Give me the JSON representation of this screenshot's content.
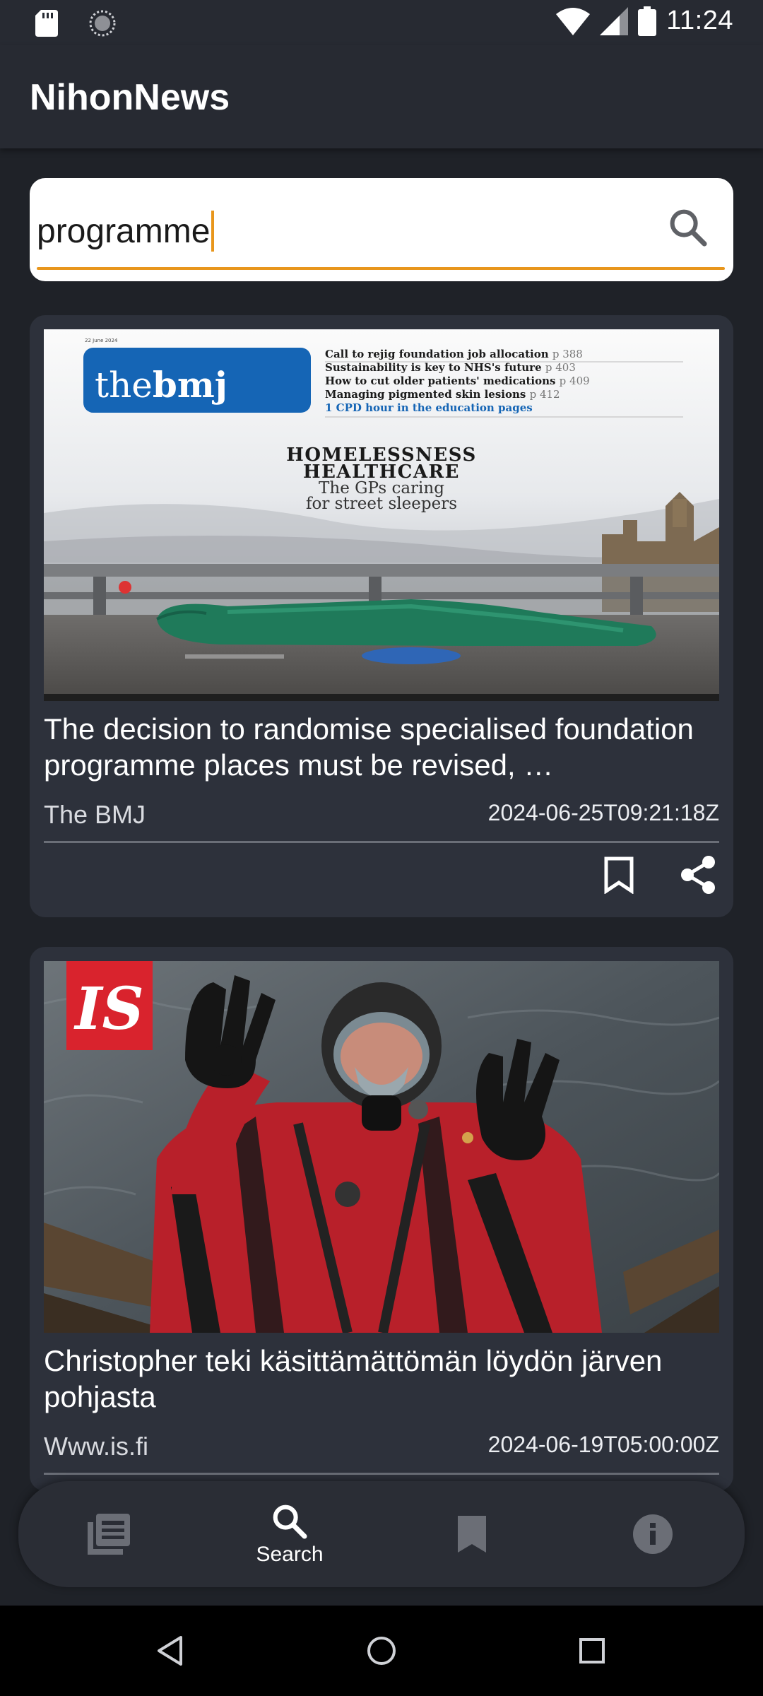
{
  "status_bar": {
    "time": "11:24",
    "icons": [
      "sd-card-icon",
      "sync-icon",
      "wifi-icon",
      "signal-icon",
      "battery-icon"
    ]
  },
  "app_bar": {
    "title": "NihonNews"
  },
  "search": {
    "value": "programme",
    "placeholder": "",
    "accent_color": "#e8961c"
  },
  "articles": [
    {
      "title": "The decision to randomise specialised foundation programme places must be revised, …",
      "source": "The BMJ",
      "date": "2024-06-25T09:21:18Z",
      "image": {
        "masthead": "the",
        "masthead_bold": "bmj",
        "issue_line": "22 June 2024",
        "contents": [
          {
            "text": "Call to rejig foundation job allocation",
            "page": "p 388"
          },
          {
            "text": "Sustainability is key to NHS's future",
            "page": "p 403"
          },
          {
            "text": "How to cut older patients' medications",
            "page": "p 409"
          },
          {
            "text": "Managing pigmented skin lesions",
            "page": "p 412"
          },
          {
            "text": "1 CPD hour in the education pages",
            "page": ""
          }
        ],
        "headline_1": "HOMELESSNESS",
        "headline_2": "HEALTHCARE",
        "subhead_1": "The GPs caring",
        "subhead_2": "for street sleepers"
      },
      "actions": [
        "bookmark-icon",
        "share-icon"
      ]
    },
    {
      "title": "Christopher teki käsittämättömän löydön järven pohjasta",
      "source": "Www.is.fi",
      "date": "2024-06-19T05:00:00Z",
      "image": {
        "logo": "IS"
      },
      "actions": [
        "bookmark-icon",
        "share-icon"
      ]
    }
  ],
  "bottom_nav": {
    "items": [
      {
        "name": "news",
        "icon": "newspaper-icon",
        "label": "",
        "active": false
      },
      {
        "name": "search",
        "icon": "search-icon",
        "label": "Search",
        "active": true
      },
      {
        "name": "bookmarks",
        "icon": "bookmark-icon",
        "label": "",
        "active": false
      },
      {
        "name": "info",
        "icon": "info-icon",
        "label": "",
        "active": false
      }
    ]
  },
  "colors": {
    "background": "#1f2228",
    "app_bar": "#272a32",
    "card": "#2d313b",
    "accent": "#e8961c",
    "bmj_blue": "#1565b5",
    "is_red": "#d9232d"
  }
}
